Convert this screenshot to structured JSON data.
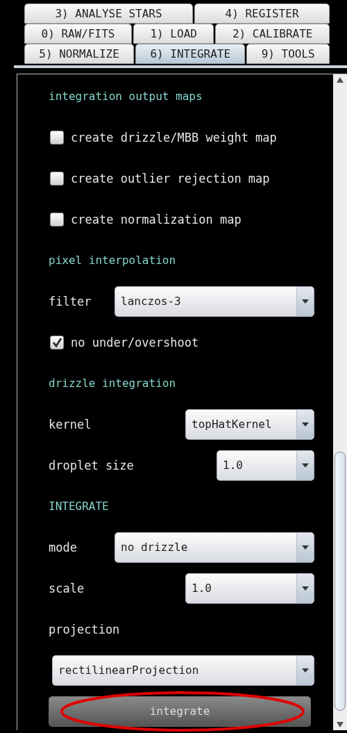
{
  "tab_rows": [
    [
      {
        "label": "3) ANALYSE STARS",
        "selected": false
      },
      {
        "label": "4) REGISTER",
        "selected": false
      }
    ],
    [
      {
        "label": "0) RAW/FITS",
        "selected": false
      },
      {
        "label": "1) LOAD",
        "selected": false
      },
      {
        "label": "2) CALIBRATE",
        "selected": false
      }
    ],
    [
      {
        "label": "5) NORMALIZE",
        "selected": false
      },
      {
        "label": "6) INTEGRATE",
        "selected": true
      },
      {
        "label": "9) TOOLS",
        "selected": false
      }
    ]
  ],
  "items": [
    {
      "kind": "heading",
      "label": "integration output maps"
    },
    {
      "kind": "checkbox",
      "label": "create drizzle/MBB weight map",
      "checked": false
    },
    {
      "kind": "checkbox",
      "label": "create outlier rejection map",
      "checked": false
    },
    {
      "kind": "checkbox",
      "label": "create normalization map",
      "checked": false
    },
    {
      "kind": "heading",
      "label": "pixel interpolation"
    },
    {
      "kind": "select",
      "label": "filter",
      "value": "lanczos-3"
    },
    {
      "kind": "checkbox",
      "label": "no under/overshoot",
      "checked": true
    },
    {
      "kind": "heading",
      "label": "drizzle integration"
    },
    {
      "kind": "select",
      "label": "kernel",
      "value": "topHatKernel"
    },
    {
      "kind": "select",
      "label": "droplet size",
      "value": "1.0"
    },
    {
      "kind": "heading",
      "label": "INTEGRATE"
    },
    {
      "kind": "select",
      "label": "mode",
      "value": "no drizzle"
    },
    {
      "kind": "select",
      "label": "scale",
      "value": "1.0"
    },
    {
      "kind": "label",
      "label": "projection"
    },
    {
      "kind": "wide_select",
      "value": "rectilinearProjection"
    },
    {
      "kind": "button",
      "label": "integrate"
    }
  ]
}
